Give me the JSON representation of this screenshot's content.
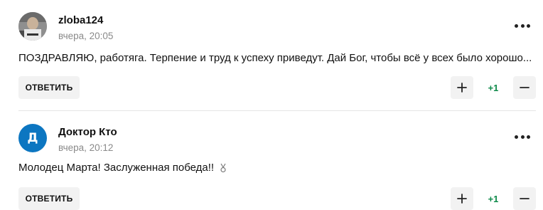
{
  "comments": [
    {
      "author": "zloba124",
      "time": "вчера, 20:05",
      "avatar_type": "photo",
      "text": "ПОЗДРАВЛЯЮ, работяга. Терпение и труд к успеху приведут. Дай Бог, чтобы всё у всех было хорошо...",
      "reply_label": "ОТВЕТИТЬ",
      "score": "+1"
    },
    {
      "author": "Доктор Кто",
      "time": "вчера, 20:12",
      "avatar_type": "letter",
      "avatar_letter": "Д",
      "avatar_color": "#0c76c1",
      "text": "Молодец Марта! Заслуженная победа!!",
      "reply_label": "ОТВЕТИТЬ",
      "score": "+1"
    }
  ],
  "colors": {
    "score_positive": "#0e8a4a",
    "button_bg": "#f2f2f2",
    "meta_text": "#8a8a8a"
  },
  "icons": {
    "more": "more-dots-icon",
    "upvote": "plus-icon",
    "downvote": "minus-icon",
    "medal": "medal-icon"
  }
}
